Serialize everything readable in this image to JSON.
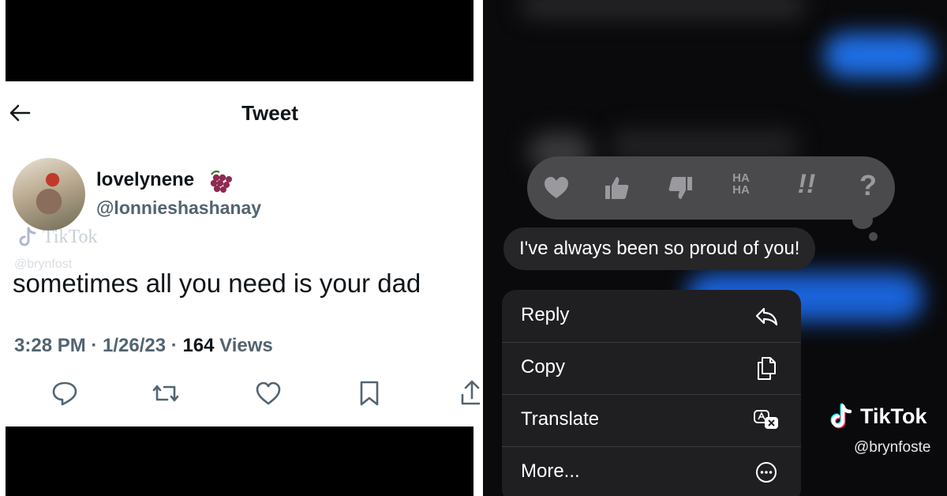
{
  "left": {
    "header_title": "Tweet",
    "author": {
      "display_name": "lovelynene",
      "handle": "@lonnieshashanay"
    },
    "watermark": {
      "brand": "TikTok",
      "handle": "@brynfost"
    },
    "tweet_text": "sometimes all you need is your dad",
    "meta": {
      "time": "3:28 PM",
      "separator": " · ",
      "date": "1/26/23",
      "views_count": "164",
      "views_label": "Views"
    },
    "actions": [
      "reply-icon",
      "retweet-icon",
      "like-icon",
      "bookmark-icon",
      "share-icon"
    ]
  },
  "right": {
    "reactions": [
      "heart-icon",
      "thumbs-up-icon",
      "thumbs-down-icon",
      "haha-icon",
      "exclamation-icon",
      "question-icon"
    ],
    "reaction_haha_text": "HA HA",
    "reaction_exclaim_text": "!!",
    "reaction_question_text": "?",
    "message_text": "I've always been so proud of you!",
    "menu": [
      {
        "label": "Reply",
        "icon": "reply-arrow-icon"
      },
      {
        "label": "Copy",
        "icon": "copy-icon"
      },
      {
        "label": "Translate",
        "icon": "translate-icon"
      },
      {
        "label": "More...",
        "icon": "more-icon"
      }
    ],
    "watermark": {
      "brand": "TikTok",
      "handle": "@brynfoste"
    }
  },
  "colors": {
    "twitter_text": "#0f1419",
    "twitter_secondary": "#536471",
    "imessage_blue": "#0a84ff",
    "menu_bg": "#1f1f22",
    "bubble_bg": "#262628"
  }
}
